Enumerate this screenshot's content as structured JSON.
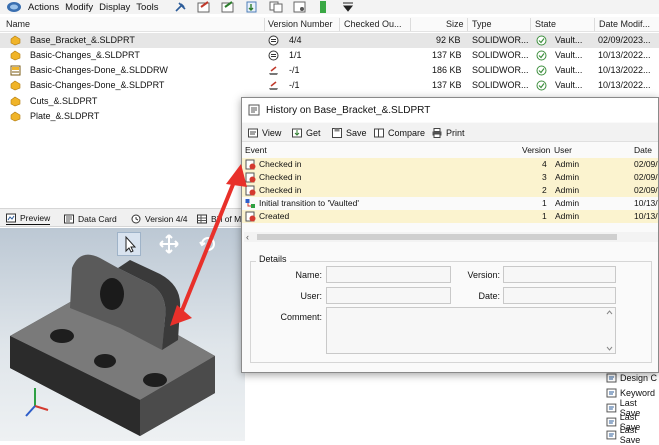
{
  "menubar": {
    "items": [
      "Actions",
      "Modify",
      "Display",
      "Tools"
    ]
  },
  "file_list": {
    "columns": [
      "Name",
      "Version Number",
      "Checked Ou...",
      "Size",
      "Type",
      "State",
      "Date Modif..."
    ],
    "rows": [
      {
        "name": "Base_Bracket_&.SLDPRT",
        "version": "4/4",
        "size": "92 KB",
        "type": "SOLIDWOR...",
        "state": "Vault...",
        "date": "02/09/2023..."
      },
      {
        "name": "Basic-Changes_&.SLDPRT",
        "version": "1/1",
        "size": "137 KB",
        "type": "SOLIDWOR...",
        "state": "Vault...",
        "date": "10/13/2022..."
      },
      {
        "name": "Basic-Changes-Done_&.SLDDRW",
        "version": "-/1",
        "size": "186 KB",
        "type": "SOLIDWOR...",
        "state": "Vault...",
        "date": "10/13/2022..."
      },
      {
        "name": "Basic-Changes-Done_&.SLDPRT",
        "version": "-/1",
        "size": "137 KB",
        "type": "SOLIDWOR...",
        "state": "Vault...",
        "date": "10/13/2022..."
      },
      {
        "name": "Cuts_&.SLDPRT"
      },
      {
        "name": "Plate_&.SLDPRT"
      }
    ]
  },
  "preview_tabs": [
    "Preview",
    "Data Card",
    "Version 4/4",
    "Bill of M"
  ],
  "props_panel": {
    "items": [
      "Design C",
      "Keyword",
      "Last Save",
      "Last Save",
      "Last Save"
    ]
  },
  "history_dialog": {
    "title": "History on Base_Bracket_&.SLDPRT",
    "toolbar": [
      "View",
      "Get",
      "Save",
      "Compare",
      "Print"
    ],
    "columns": [
      "Event",
      "Version",
      "User",
      "Date"
    ],
    "rows": [
      {
        "event": "Checked in",
        "version": "4",
        "user": "Admin",
        "date": "02/09/"
      },
      {
        "event": "Checked in",
        "version": "3",
        "user": "Admin",
        "date": "02/09/"
      },
      {
        "event": "Checked in",
        "version": "2",
        "user": "Admin",
        "date": "02/09/"
      },
      {
        "event": "Initial transition to 'Vaulted'",
        "version": "1",
        "user": "Admin",
        "date": "10/13/"
      },
      {
        "event": "Created",
        "version": "1",
        "user": "Admin",
        "date": "10/13/"
      }
    ],
    "details": {
      "group_label": "Details",
      "name_label": "Name:",
      "user_label": "User:",
      "comment_label": "Comment:",
      "version_label": "Version:",
      "date_label": "Date:"
    }
  },
  "colors": {
    "arrow": "#e8302a",
    "row_highlight": "#fbf3cf",
    "selection": "#e6e6e6",
    "folder_icon": "#f0b429",
    "state_check": "#3d8f3d"
  }
}
